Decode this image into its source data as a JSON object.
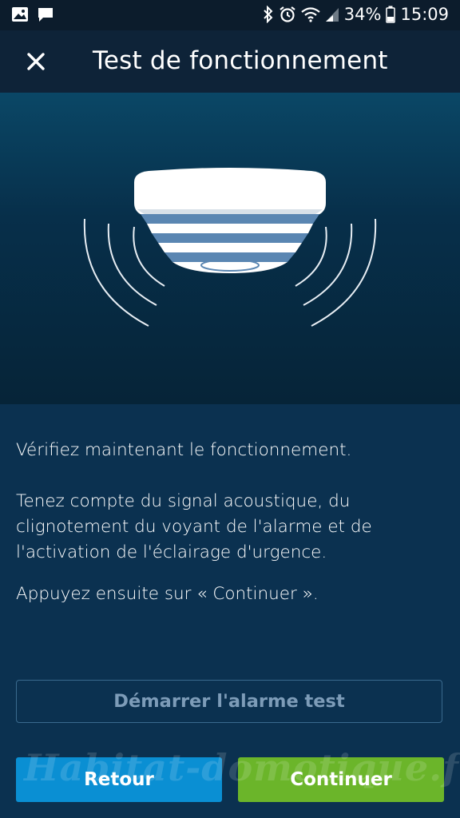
{
  "status_bar": {
    "battery": "34%",
    "time": "15:09",
    "icons": [
      "image-icon",
      "chat-icon",
      "bluetooth-icon",
      "alarm-icon",
      "wifi-icon",
      "signal-icon",
      "battery-icon"
    ]
  },
  "app_bar": {
    "close_icon": "close-icon",
    "title": "Test de fonctionnement"
  },
  "hero": {
    "illustration": "smoke-detector-icon"
  },
  "content": {
    "para1": "Vérifiez maintenant le fonctionnement.",
    "para2": "Tenez compte du signal acoustique, du clignotement du voyant de l'alarme et de l'activation de l'éclairage d'urgence.",
    "para3": "Appuyez ensuite sur « Continuer »."
  },
  "buttons": {
    "test_alarm": "Démarrer l'alarme test",
    "back": "Retour",
    "continue": "Continuer"
  },
  "watermark": "Habitat-domotique.fr",
  "colors": {
    "background": "#0b3150",
    "back_button": "#0a8fd3",
    "continue_button": "#6bb52a",
    "outline_button_border": "#3a6a8e"
  }
}
